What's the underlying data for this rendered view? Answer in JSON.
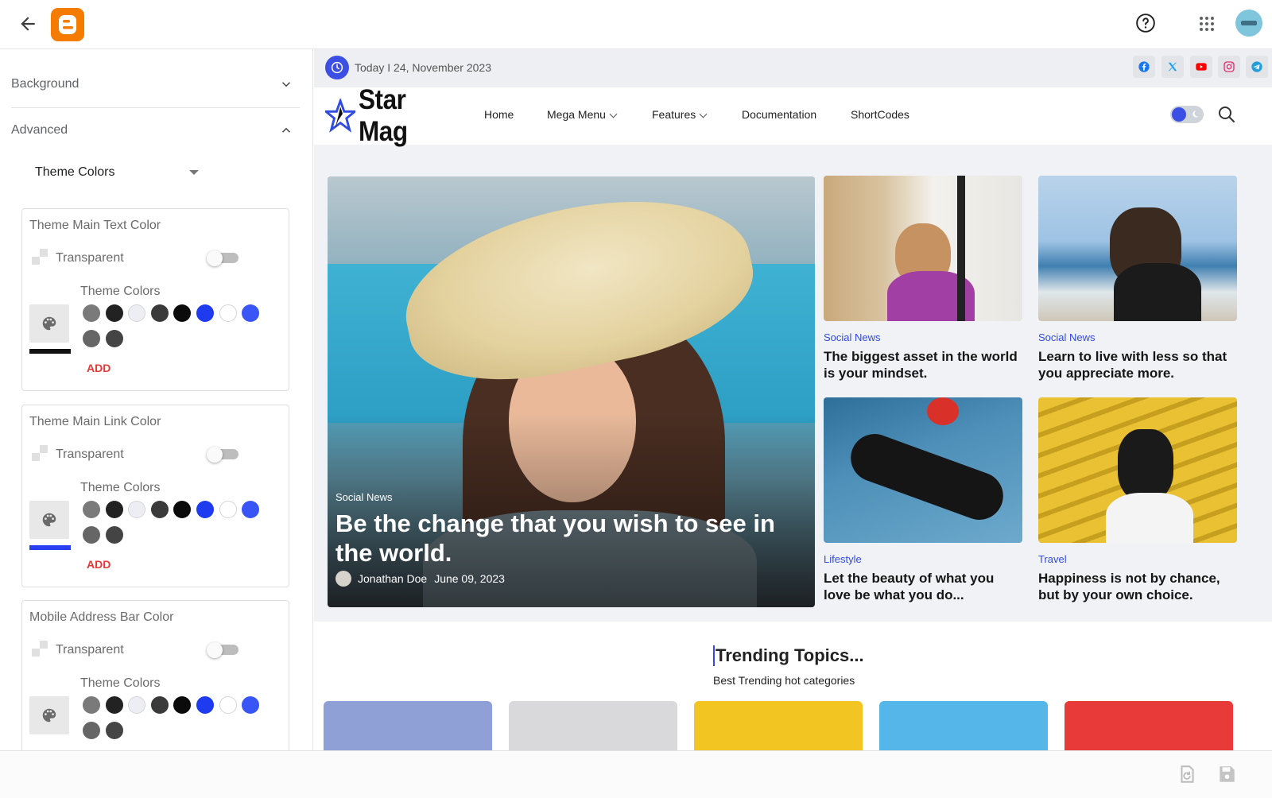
{
  "colors": {
    "accent": "#3b4fe4",
    "add": "#e53935",
    "category": "#2f4be0",
    "blogger_orange": "#f57c00"
  },
  "topbar": {
    "icons": [
      "back-arrow-icon",
      "blogger-logo",
      "help-icon",
      "apps-grid-icon",
      "avatar"
    ]
  },
  "left_panel": {
    "sections": [
      {
        "label": "Background",
        "expanded": false
      },
      {
        "label": "Advanced",
        "expanded": true
      }
    ],
    "dropdown": {
      "selected": "Theme Colors"
    },
    "cards": [
      {
        "title": "Theme Main Text Color",
        "transparent_label": "Transparent",
        "theme_colors_label": "Theme Colors",
        "add_label": "ADD",
        "current_color": "#111111",
        "swatches": [
          "#7a7a7a",
          "#222222",
          "#eceef3",
          "#3a3a3a",
          "#0b0b0b",
          "#1f3bf0",
          "#ffffff",
          "#3a55f5",
          "#666666",
          "#444444"
        ]
      },
      {
        "title": "Theme Main Link Color",
        "transparent_label": "Transparent",
        "theme_colors_label": "Theme Colors",
        "add_label": "ADD",
        "current_color": "#2a3ff2",
        "swatches": [
          "#7a7a7a",
          "#222222",
          "#eceef3",
          "#3a3a3a",
          "#0b0b0b",
          "#1f3bf0",
          "#ffffff",
          "#3a55f5",
          "#666666",
          "#444444"
        ]
      },
      {
        "title": "Mobile Address Bar Color",
        "transparent_label": "Transparent",
        "theme_colors_label": "Theme Colors",
        "add_label": "ADD",
        "current_color": "",
        "swatches": [
          "#7a7a7a",
          "#222222",
          "#eceef3",
          "#3a3a3a",
          "#0b0b0b",
          "#1f3bf0",
          "#ffffff",
          "#3a55f5",
          "#666666",
          "#444444"
        ]
      }
    ]
  },
  "preview": {
    "date_text": "Today I 24, November 2023",
    "social_icons": [
      "facebook-icon",
      "x-twitter-icon",
      "youtube-icon",
      "instagram-icon",
      "telegram-icon"
    ],
    "site_name": "Star Mag",
    "nav": [
      {
        "label": "Home",
        "has_caret": false
      },
      {
        "label": "Mega Menu",
        "has_caret": true
      },
      {
        "label": "Features",
        "has_caret": true
      },
      {
        "label": "Documentation",
        "has_caret": false
      },
      {
        "label": "ShortCodes",
        "has_caret": false
      }
    ],
    "hero": {
      "category": "Social News",
      "title": "Be the change that you wish to see in the world.",
      "author": "Jonathan Doe",
      "date": "June 09, 2023"
    },
    "posts": [
      {
        "category": "Social News",
        "title": "The biggest asset in the world is your mindset."
      },
      {
        "category": "Social News",
        "title": "Learn to live with less so that you appreciate more."
      },
      {
        "category": "Lifestyle",
        "title": "Let the beauty of what you love be what you do..."
      },
      {
        "category": "Travel",
        "title": "Happiness is not by chance, but by your own choice."
      }
    ],
    "trending": {
      "title": "Trending Topics...",
      "subtitle": "Best Trending hot categories"
    }
  },
  "bottom_bar": {
    "icons": [
      "revert-icon",
      "save-icon"
    ]
  }
}
